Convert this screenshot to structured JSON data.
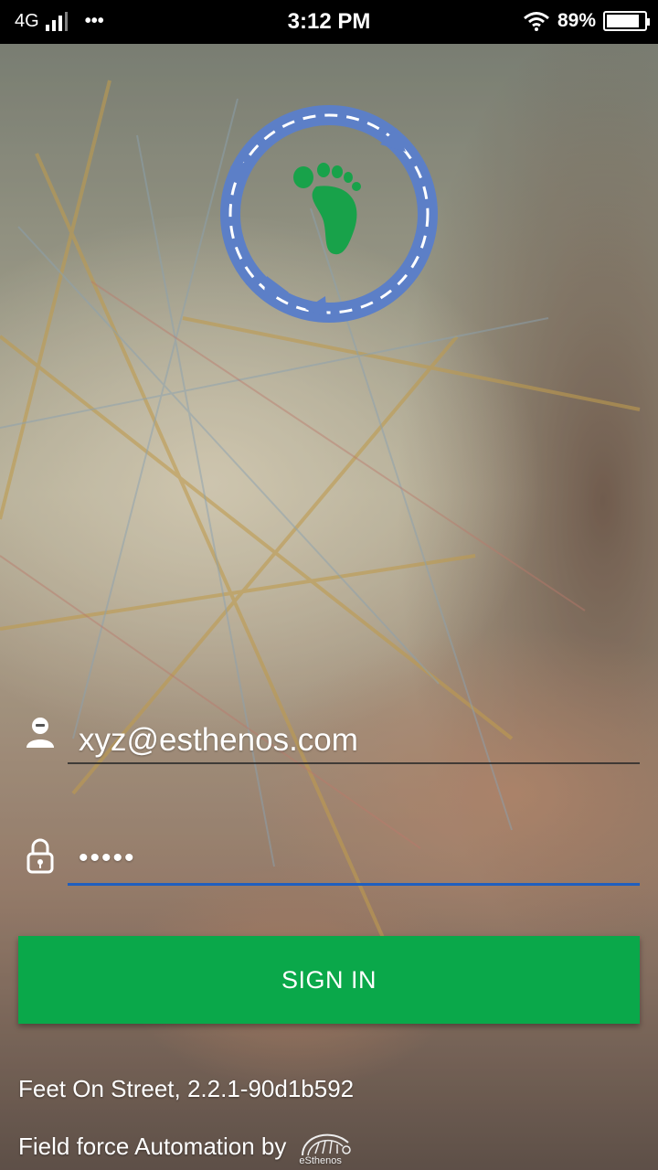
{
  "status_bar": {
    "network": "4G",
    "more": "•••",
    "time": "3:12 PM",
    "battery_text": "89%",
    "battery_level": 0.89
  },
  "login": {
    "email_value": "xyz@esthenos.com",
    "password_value": "•••••"
  },
  "sign_in_label": "SIGN IN",
  "footer": {
    "version": "Feet On Street, 2.2.1-90d1b592",
    "byline": "Field force Automation by",
    "brand": "eSthenos"
  },
  "colors": {
    "accent_green": "#0aa84a",
    "focus_blue": "#1f5fbf",
    "logo_blue": "#5c7fc7",
    "footprint_green": "#18a24a"
  },
  "icons": {
    "user": "user-icon",
    "lock": "lock-icon",
    "wifi": "wifi-icon",
    "signal": "signal-icon",
    "battery": "battery-icon",
    "logo": "footprint-logo"
  }
}
